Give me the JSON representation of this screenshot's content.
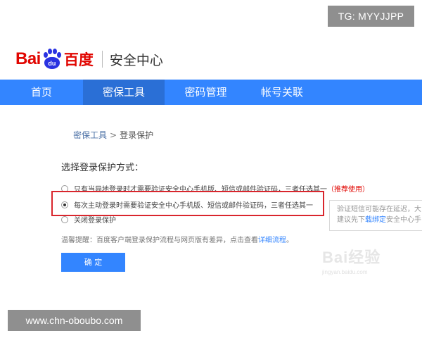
{
  "overlay": {
    "tg_label": "TG: MYYJJPP",
    "site_label": "www.chn-oboubo.com"
  },
  "header": {
    "logo_bai": "Bai",
    "logo_du": "du",
    "logo_cn": "百度",
    "title": "安全中心"
  },
  "nav": {
    "items": [
      {
        "label": "首页"
      },
      {
        "label": "密保工具"
      },
      {
        "label": "密码管理"
      },
      {
        "label": "帐号关联"
      }
    ]
  },
  "breadcrumb": {
    "parent": "密保工具",
    "separator": ">",
    "current": "登录保护"
  },
  "section": {
    "title": "选择登录保护方式："
  },
  "options": [
    {
      "text": "只有当异地登录时才需要验证安全中心手机版、短信或邮件验证码，三者任选其一",
      "recommend": "（推荐使用）",
      "checked": false
    },
    {
      "text": "每次主动登录时需要验证安全中心手机版、短信或邮件验证码，三者任选其一",
      "checked": true
    },
    {
      "text": "关闭登录保护",
      "checked": false
    }
  ],
  "tooltip": {
    "line1": "验证短信可能存在延迟，大",
    "line2_prefix": "建议先下",
    "line2_link": "载绑定",
    "line2_suffix": "安全中心手"
  },
  "tip": {
    "text": "温馨提醒：百度客户端登录保护流程与网页版有差异，点击查看",
    "link": "详细流程",
    "end": "。"
  },
  "button": {
    "confirm": "确 定"
  },
  "watermark": {
    "mark": "Bai经验",
    "sub": "jingyan.baidu.com"
  }
}
